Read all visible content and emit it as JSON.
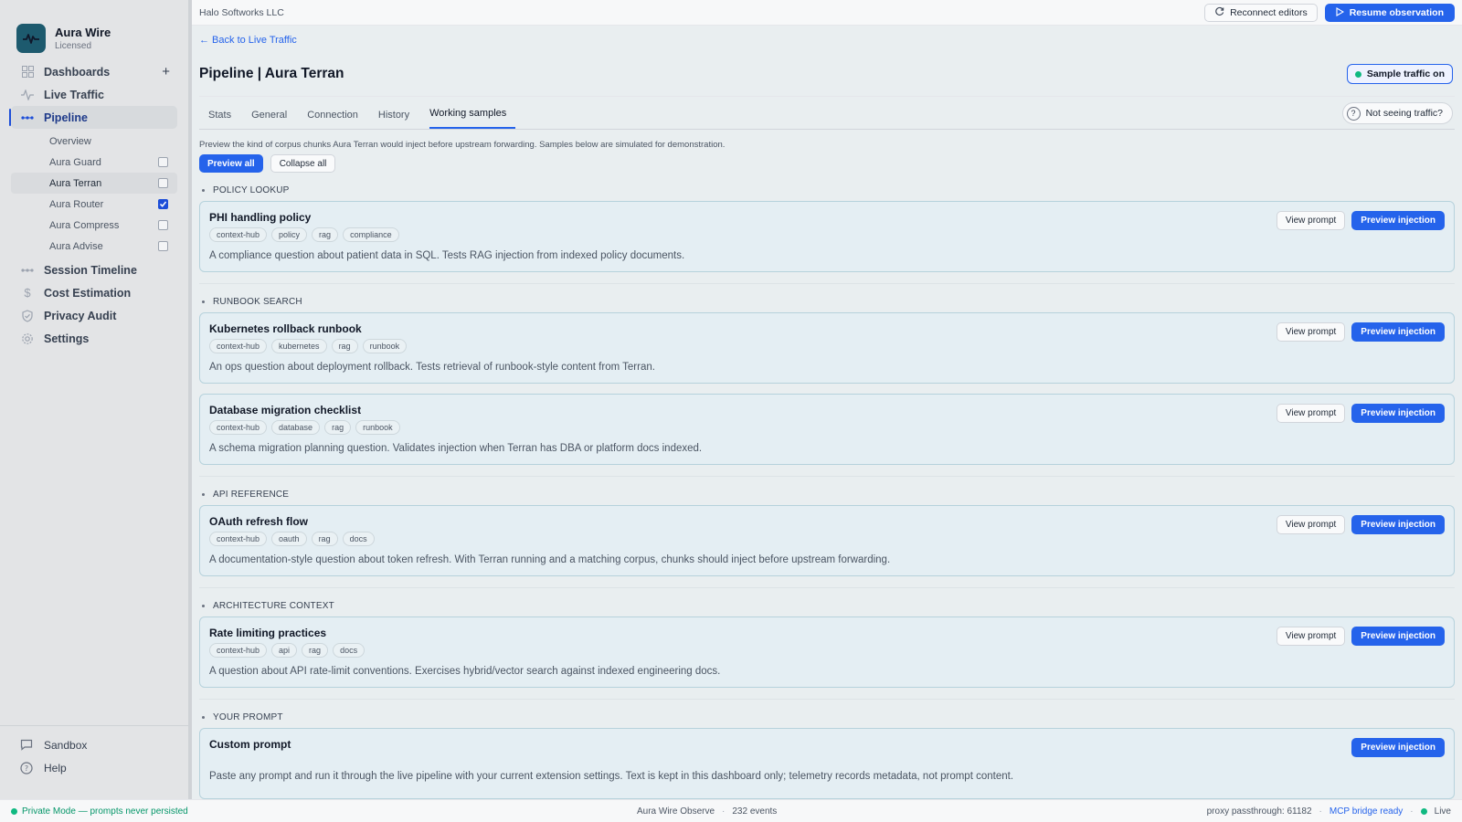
{
  "app": {
    "name": "Aura Wire",
    "license": "Licensed"
  },
  "sidebar": {
    "items": [
      {
        "label": "Dashboards",
        "icon": "grid-icon"
      },
      {
        "label": "Live Traffic",
        "icon": "activity-icon"
      },
      {
        "label": "Pipeline",
        "icon": "pipeline-icon"
      },
      {
        "label": "Session Timeline",
        "icon": "timeline-icon"
      },
      {
        "label": "Cost Estimation",
        "icon": "dollar-icon"
      },
      {
        "label": "Privacy Audit",
        "icon": "shield-icon"
      },
      {
        "label": "Settings",
        "icon": "gear-icon"
      }
    ],
    "plus": "+",
    "pipeline_sub": [
      {
        "label": "Overview"
      },
      {
        "label": "Aura Guard",
        "checked": false
      },
      {
        "label": "Aura Terran",
        "checked": false
      },
      {
        "label": "Aura Router",
        "checked": true
      },
      {
        "label": "Aura Compress",
        "checked": false
      },
      {
        "label": "Aura Advise",
        "checked": false
      }
    ],
    "bottom": [
      {
        "label": "Sandbox",
        "icon": "chat-icon"
      },
      {
        "label": "Help",
        "icon": "help-icon"
      }
    ]
  },
  "header": {
    "org": "Halo Softworks LLC",
    "reconnect_label": "Reconnect editors",
    "resume_label": "Resume observation"
  },
  "page": {
    "back_link": "← Back to Live Traffic",
    "title": "Pipeline | Aura Terran",
    "sample_traffic_label": "Sample traffic on",
    "tabs": [
      "Stats",
      "General",
      "Connection",
      "History",
      "Working samples"
    ],
    "active_tab": "Working samples",
    "help_label": "Not seeing traffic?",
    "help_glyph": "?",
    "description": "Preview the kind of corpus chunks Aura Terran would inject before upstream forwarding. Samples below are simulated for demonstration.",
    "preview_all_label": "Preview all",
    "collapse_all_label": "Collapse all",
    "view_prompt_label": "View prompt",
    "preview_injection_label": "Preview injection"
  },
  "sections": [
    {
      "title": "POLICY LOOKUP",
      "cards": [
        {
          "title": "PHI handling policy",
          "tags": [
            "context-hub",
            "policy",
            "rag",
            "compliance"
          ],
          "desc": "A compliance question about patient data in SQL. Tests RAG injection from indexed policy documents."
        }
      ]
    },
    {
      "title": "RUNBOOK SEARCH",
      "cards": [
        {
          "title": "Kubernetes rollback runbook",
          "tags": [
            "context-hub",
            "kubernetes",
            "rag",
            "runbook"
          ],
          "desc": "An ops question about deployment rollback. Tests retrieval of runbook-style content from Terran."
        },
        {
          "title": "Database migration checklist",
          "tags": [
            "context-hub",
            "database",
            "rag",
            "runbook"
          ],
          "desc": "A schema migration planning question. Validates injection when Terran has DBA or platform docs indexed."
        }
      ]
    },
    {
      "title": "API REFERENCE",
      "cards": [
        {
          "title": "OAuth refresh flow",
          "tags": [
            "context-hub",
            "oauth",
            "rag",
            "docs"
          ],
          "desc": "A documentation-style question about token refresh. With Terran running and a matching corpus, chunks should inject before upstream forwarding."
        }
      ]
    },
    {
      "title": "ARCHITECTURE CONTEXT",
      "cards": [
        {
          "title": "Rate limiting practices",
          "tags": [
            "context-hub",
            "api",
            "rag",
            "docs"
          ],
          "desc": "A question about API rate-limit conventions. Exercises hybrid/vector search against indexed engineering docs."
        }
      ]
    },
    {
      "title": "YOUR PROMPT",
      "cards": [
        {
          "title": "Custom prompt",
          "tags": [],
          "desc": "Paste any prompt and run it through the live pipeline with your current extension settings. Text is kept in this dashboard only; telemetry records metadata, not prompt content.",
          "custom": true
        }
      ]
    }
  ],
  "statusbar": {
    "private_mode": "Private Mode — prompts never persisted",
    "app_name": "Aura Wire Observe",
    "events": "232 events",
    "proxy": "proxy passthrough: 61182",
    "mcp": "MCP bridge ready",
    "live": "Live",
    "separator": "·"
  },
  "colors": {
    "accent": "#2563eb",
    "status_ok": "#10b981",
    "card_bg": "#e4eef3"
  }
}
